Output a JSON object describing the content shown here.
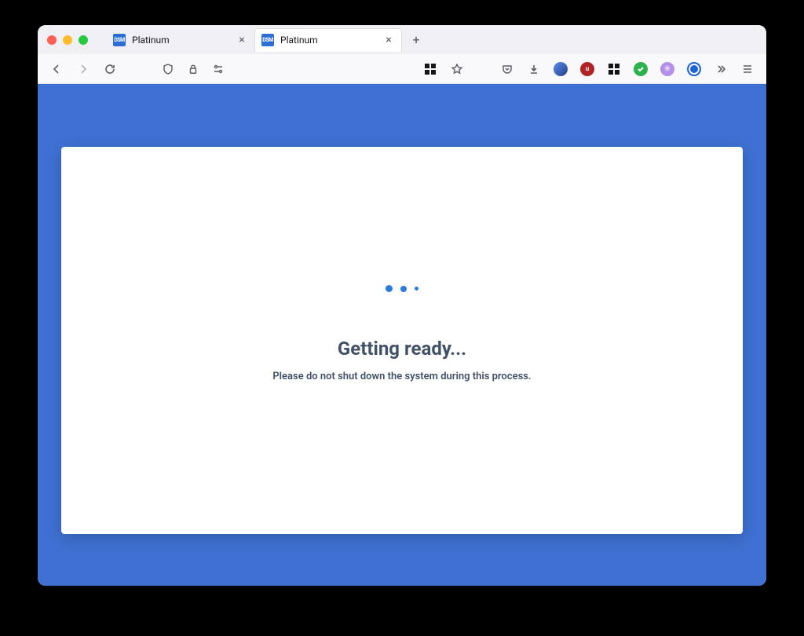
{
  "tabs": [
    {
      "title": "Platinum",
      "favicon_text": "DSM",
      "active": false
    },
    {
      "title": "Platinum",
      "favicon_text": "DSM",
      "active": true
    }
  ],
  "content": {
    "heading": "Getting ready...",
    "subtext": "Please do not shut down the system during this process."
  },
  "colors": {
    "page_bg": "#3e71d2",
    "loading_dot": "#2b7cd9",
    "text": "#415168"
  }
}
